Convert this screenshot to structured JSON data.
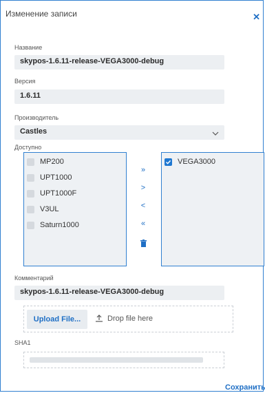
{
  "dialog": {
    "title": "Изменение записи"
  },
  "fields": {
    "name": {
      "label": "Название",
      "value": "skypos-1.6.11-release-VEGA3000-debug"
    },
    "version": {
      "label": "Версия",
      "value": "1.6.11"
    },
    "manufacturer": {
      "label": "Производитель",
      "value": "Castles"
    }
  },
  "available": {
    "label": "Доступно",
    "items": [
      "MP200",
      "UPT1000",
      "UPT1000F",
      "V3UL",
      "Saturn1000"
    ]
  },
  "selected": {
    "items": [
      "VEGA3000"
    ]
  },
  "controls": {
    "move_all_right": "»",
    "move_right": ">",
    "move_left": "<",
    "move_all_left": "«"
  },
  "comment": {
    "label": "Комментарий",
    "value": "skypos-1.6.11-release-VEGA3000-debug"
  },
  "upload": {
    "button": "Upload File...",
    "drop": "Drop file here"
  },
  "sha1": {
    "label": "SHA1"
  },
  "actions": {
    "save": "Сохранить"
  },
  "colors": {
    "accent": "#1f78d1",
    "border": "#2f7fd0",
    "field_bg": "#eceff2"
  }
}
